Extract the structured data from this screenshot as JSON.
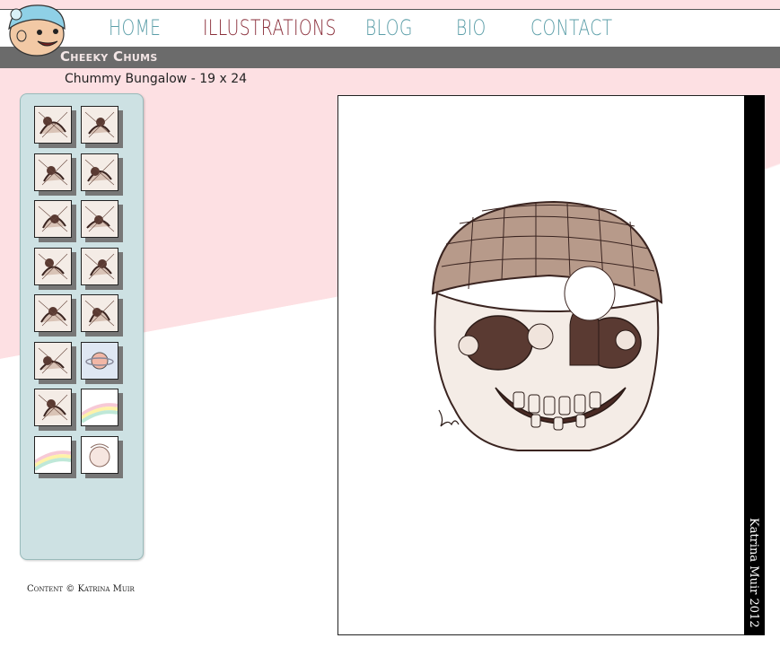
{
  "nav": {
    "items": [
      {
        "label": "HOME",
        "color": "#5b9ea8"
      },
      {
        "label": "ILLUSTRATIONS",
        "color": "#8a2e3a"
      },
      {
        "label": "BLOG",
        "color": "#5b9ea8"
      },
      {
        "label": "BIO",
        "color": "#5b9ea8"
      },
      {
        "label": "CONTACT",
        "color": "#5b9ea8"
      }
    ]
  },
  "section": {
    "title": "Cheeky Chums",
    "caption": "Chummy Bungalow - 19 x 24"
  },
  "gallery": {
    "thumbnails": [
      {
        "style": "ink"
      },
      {
        "style": "ink"
      },
      {
        "style": "ink"
      },
      {
        "style": "ink"
      },
      {
        "style": "ink"
      },
      {
        "style": "ink"
      },
      {
        "style": "ink"
      },
      {
        "style": "ink"
      },
      {
        "style": "ink"
      },
      {
        "style": "ink"
      },
      {
        "style": "ink"
      },
      {
        "style": "planet"
      },
      {
        "style": "ink"
      },
      {
        "style": "rainbow"
      },
      {
        "style": "rainbow"
      },
      {
        "style": "ink-light"
      }
    ]
  },
  "footer": {
    "credit": "Content © Katrina Muir"
  },
  "viewer": {
    "signature": "Katrina Muir 2012",
    "artwork_icon": "skull-house-illustration"
  },
  "colors": {
    "pink": "#fde0e3",
    "sidebar": "#cde1e3",
    "nav_active": "#8a2e3a",
    "nav_default": "#5b9ea8"
  }
}
